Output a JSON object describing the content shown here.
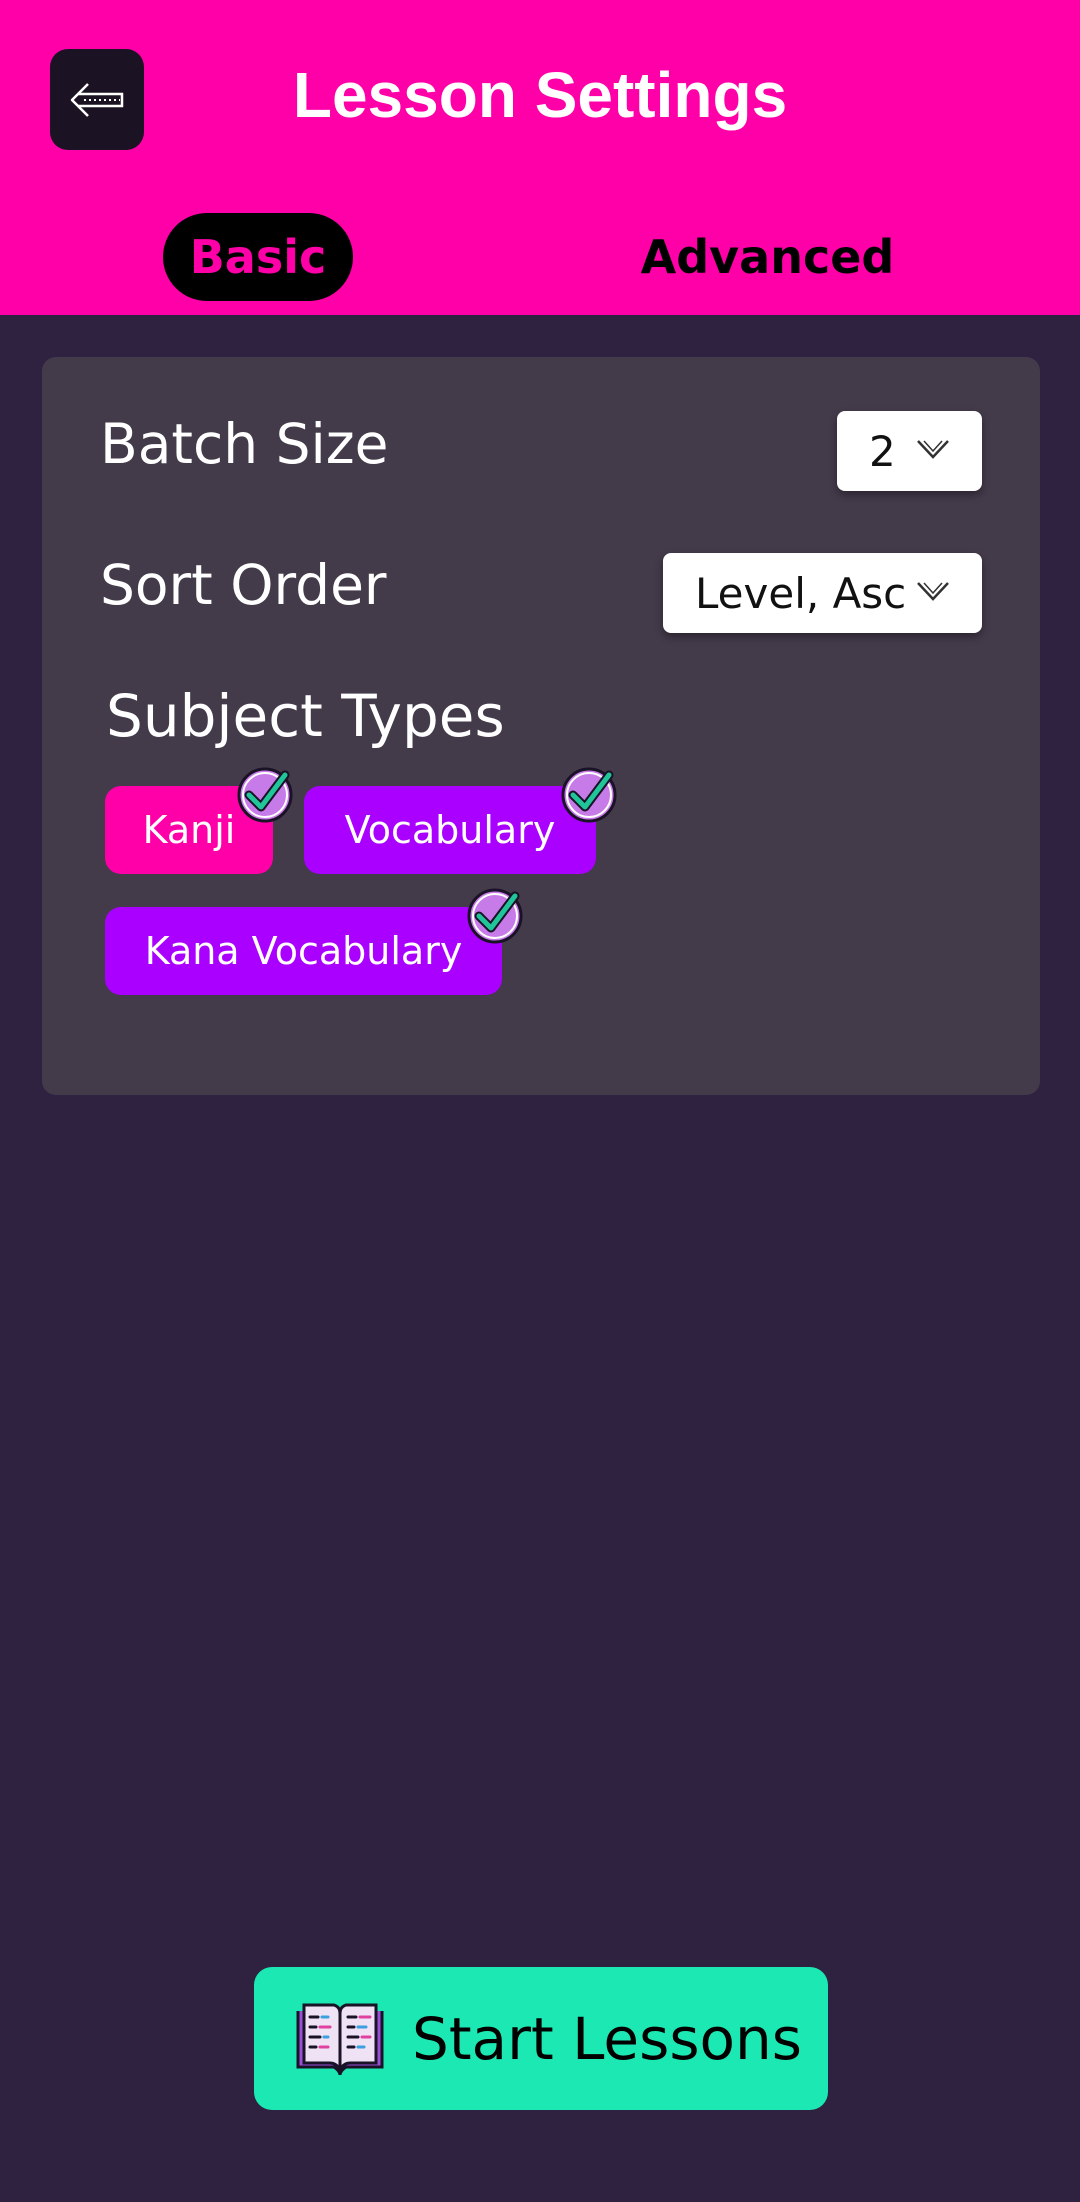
{
  "header": {
    "title": "Lesson Settings",
    "background": "#ff00a8",
    "back_icon": "arrow-left-icon"
  },
  "tabs": [
    {
      "label": "Basic",
      "selected": true
    },
    {
      "label": "Advanced",
      "selected": false
    }
  ],
  "settings": {
    "batch_size": {
      "label": "Batch Size",
      "value": "2"
    },
    "sort_order": {
      "label": "Sort Order",
      "value": "Level, Asc"
    }
  },
  "subject_types": {
    "title": "Subject Types",
    "items": [
      {
        "label": "Kanji",
        "checked": true,
        "color": "#ff00a8"
      },
      {
        "label": "Vocabulary",
        "checked": true,
        "color": "#aa00ff"
      },
      {
        "label": "Kana Vocabulary",
        "checked": true,
        "color": "#aa00ff"
      }
    ]
  },
  "start_button": {
    "label": "Start Lessons",
    "icon": "open-book-icon",
    "color": "#1be8b3"
  }
}
